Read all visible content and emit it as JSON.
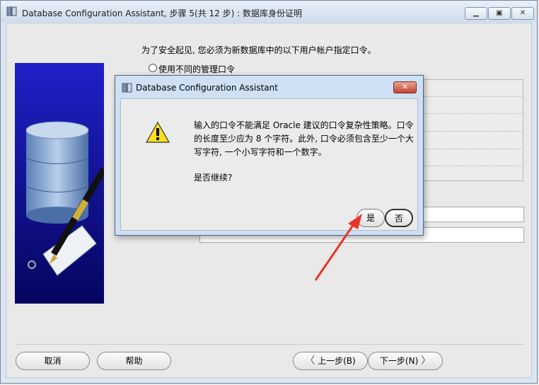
{
  "window": {
    "title": "Database Configuration Assistant, 步骤 5(共 12 步) : 数据库身份证明"
  },
  "main": {
    "instruction": "为了安全起见, 您必须为新数据库中的以下用户帐户指定口令。",
    "radio_label": "使用不同的管理口令"
  },
  "footer": {
    "cancel_label": "取消",
    "help_label": "帮助",
    "back_label": "上一步(B)",
    "next_label": "下一步(N)"
  },
  "dialog": {
    "title": "Database Configuration Assistant",
    "message": "输入的口令不能满足 Oracle 建议的口令复杂性策略。口令的长度至少应为 8 个字符。此外, 口令必须包含至少一个大写字符, 一个小写字符和一个数字。",
    "question": "是否继续?",
    "yes_label": "是",
    "no_label": "否"
  },
  "colors": {
    "annotation_arrow": "#e8342a",
    "sidebar_blue": "#1a1aa8"
  }
}
